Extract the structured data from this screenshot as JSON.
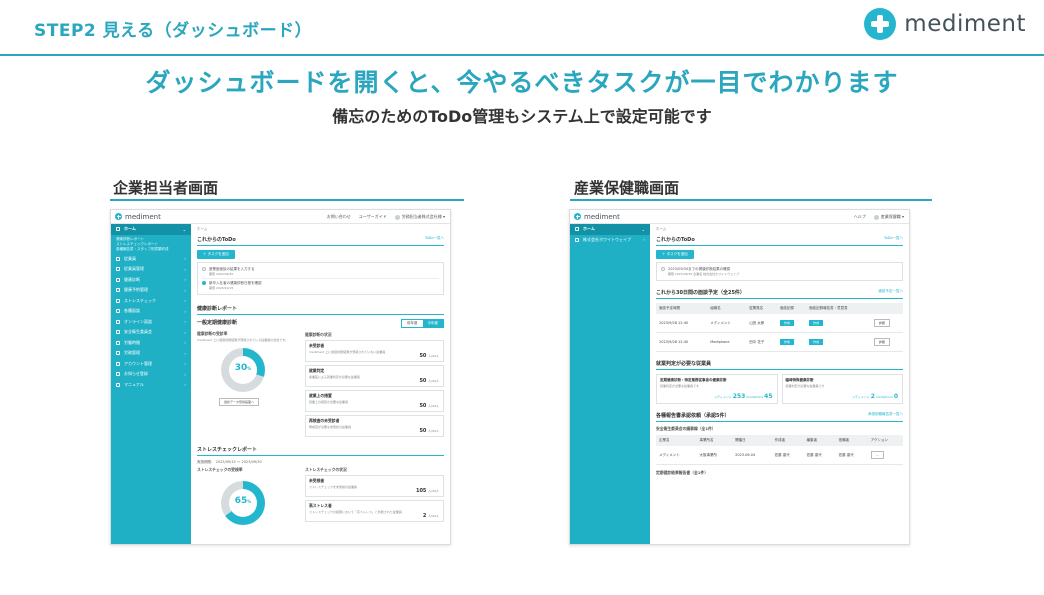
{
  "slide": {
    "step": "STEP2 見える（ダッシュボード）",
    "brand": "mediment",
    "headline": "ダッシュボードを開くと、今やるべきタスクが一目でわかります",
    "subline": "備忘のためのToDo管理もシステム上で設定可能です"
  },
  "colors": {
    "accent": "#2aa7bf",
    "sidebar": "#1fb0c6",
    "text": "#333333"
  },
  "left": {
    "section_title": "企業担当者画面",
    "app": {
      "name": "mediment",
      "top_links": [
        "お問い合わせ",
        "ユーザーガイド"
      ],
      "user": "労務担当者株式会社様"
    },
    "sidebar": {
      "home": "ホーム",
      "sub_items": [
        "健康診断レポート",
        "ストレスチェックレポート",
        "各種報告書・スタッフ別書類作成"
      ],
      "items": [
        "従業員",
        "従業員管理",
        "健康診断",
        "健康予約管理",
        "ストレスチェック",
        "各種面談",
        "オンライン面談",
        "安全衛生委員会",
        "労働時間",
        "労務管理",
        "アカウント管理",
        "お知らせ登録",
        "マニュアル"
      ]
    },
    "main": {
      "crumb": "ホーム",
      "todo_title": "これからのToDo",
      "todo_link": "ToDo一覧へ",
      "add_task": "＋ タスクを追加",
      "todos": [
        {
          "title": "産業医面談の結果を入力する",
          "meta": "期限 2023/09/30"
        },
        {
          "title": "新卒入社者の健康診断日程を確認",
          "meta": "期限 2023/10/15"
        }
      ],
      "health_report_title": "健康診断レポート",
      "general_checkup": "一般定期健康診断",
      "toggle": [
        "前年度",
        "今年度"
      ],
      "rate_label": "健康診断の受診率",
      "rate_desc": "mediment 上に健康診断結果が登録されている従業員の割合です。",
      "rate_value": "30",
      "rate_unit": "%",
      "rate_button": "健診データ登録画面へ",
      "status_title": "健康診断の状況",
      "status_cards": [
        {
          "title": "未受診者",
          "desc": "mediment 上に健康診断結果が登録されていない従業員",
          "num": "50",
          "unit": "人/99人"
        },
        {
          "title": "就業判定",
          "desc": "産業医による就業判定が必要な従業員",
          "num": "50",
          "unit": "人/99人"
        },
        {
          "title": "就業上の措置",
          "desc": "就業上の措置が必要な従業員",
          "num": "50",
          "unit": "人/99人"
        },
        {
          "title": "再検査の未受診者",
          "desc": "再検査が必要な未受診の従業員",
          "num": "50",
          "unit": "人/99人"
        }
      ],
      "stress_title": "ストレスチェックレポート",
      "stress_period": "実施期間： 2023/09/15 〜 2023/09/30",
      "stress_rate_label": "ストレスチェックの受検率",
      "stress_rate_value": "65",
      "stress_rate_unit": "%",
      "stress_status_title": "ストレスチェックの状況",
      "stress_cards": [
        {
          "title": "未受検者",
          "desc": "ストレスチェックを未受検の従業員",
          "num": "105",
          "unit": "人/99人"
        },
        {
          "title": "高ストレス者",
          "desc": "ストレスチェックの結果において「高ストレス」と判断された従業員",
          "num": "2",
          "unit": "人/99人"
        }
      ]
    }
  },
  "right": {
    "section_title": "産業保健職画面",
    "app": {
      "name": "mediment",
      "top_links": [
        "ヘルプ"
      ],
      "user": "産業保健職"
    },
    "sidebar": {
      "home": "ホーム",
      "company": "株式会社ホワイトウェイブ"
    },
    "main": {
      "crumb": "ホーム",
      "todo_title": "これからのToDo",
      "todo_link": "ToDo一覧へ",
      "add_task": "＋ タスクを追加",
      "todos": [
        {
          "title": "2023/09/30までの健康診断結果の確認",
          "meta": "期限 2023/09/30 企業名 株式会社ホワイトウェイブ"
        }
      ],
      "interview_title": "これから30日間の面談予定（全25件）",
      "interview_link": "面談予定一覧へ",
      "table_headers": [
        "面談予定時間",
        "組織名",
        "従業員名",
        "面談記録",
        "面談記録報告書・意見書",
        ""
      ],
      "table_rows": [
        {
          "time": "2023/9/28 12:40",
          "org": "メディメント",
          "name": "山田 太郎",
          "rec": "作成",
          "report": "作成",
          "action": "詳細"
        },
        {
          "time": "2023/9/28 12:40",
          "org": "Mediphone",
          "name": "田中 花子",
          "rec": "作成",
          "report": "作成",
          "action": "詳細"
        }
      ],
      "follow_title": "就業判定が必要な従業員",
      "follow_cards": [
        {
          "title": "定期健康診断・特定業務従事者の健康診断",
          "desc": "就業判定が必要な従業員です",
          "a_label": "メディメント",
          "a": "253",
          "b_label": "mediphone",
          "b": "45"
        },
        {
          "title": "臨時特殊健康診断",
          "desc": "就業判定が必要な従業員です",
          "a_label": "メディメント",
          "a": "2",
          "b_label": "mediphone",
          "b": "0"
        }
      ],
      "reports_title": "各種報告書承認依頼（承認5件）",
      "reports_link": "承認依頼報告書一覧へ",
      "reports_sub": "安全衛生委員会の議事録（全1件）",
      "report_headers": [
        "企業名",
        "事業所名",
        "開催日",
        "作成者",
        "編集者",
        "依頼者",
        "アクション"
      ],
      "report_row": {
        "company": "メディメント",
        "office": "大阪事業所",
        "date": "2023.06.04",
        "creator": "佐藤 香代",
        "editor": "佐藤 香代",
        "requester": "佐藤 香代",
        "action": "…"
      },
      "reports_sub2": "定期健診結果報告書（全1件）"
    }
  }
}
